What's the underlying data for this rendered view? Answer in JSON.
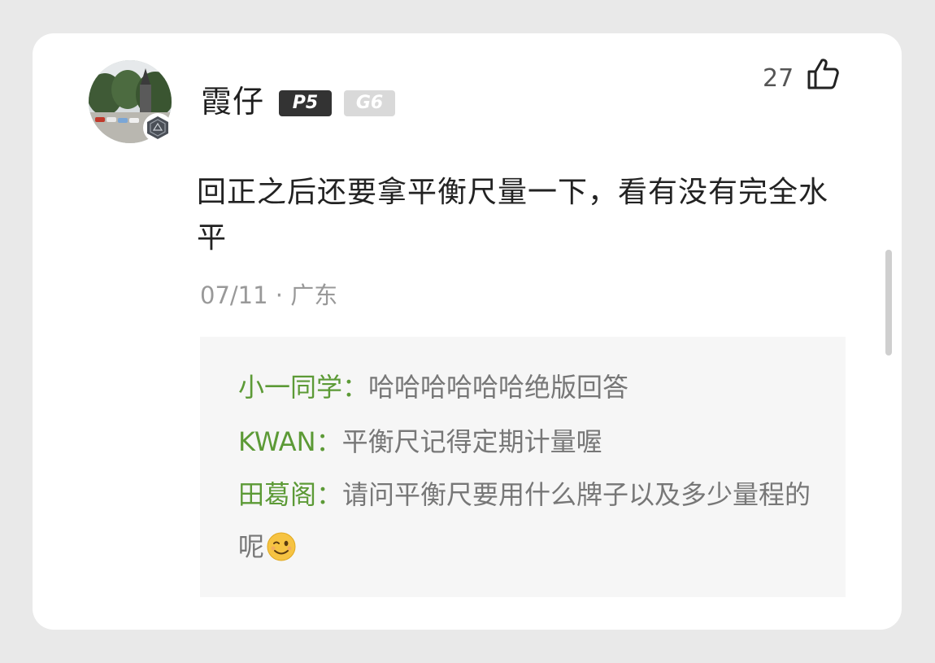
{
  "comment": {
    "username": "霞仔",
    "badges": [
      "P5",
      "G6"
    ],
    "like_count": "27",
    "content": "回正之后还要拿平衡尺量一下，看有没有完全水平",
    "date": "07/11",
    "separator": "·",
    "location": "广东",
    "icons": {
      "avatar": "user-avatar-photo",
      "avatar_badge": "hexagon-badge-icon",
      "like": "thumbs-up-icon",
      "emoji": "winking-face-emoji"
    },
    "colors": {
      "reply_author": "#5c9a36",
      "badge_primary": "#333333",
      "badge_secondary": "#d9d9d9"
    }
  },
  "replies": [
    {
      "author": "小一同学：",
      "text": "哈哈哈哈哈哈绝版回答"
    },
    {
      "author": "KWAN：",
      "text": "平衡尺记得定期计量喔"
    },
    {
      "author": "田葛阁：",
      "text": "请问平衡尺要用什么牌子以及多少量程的呢"
    }
  ]
}
